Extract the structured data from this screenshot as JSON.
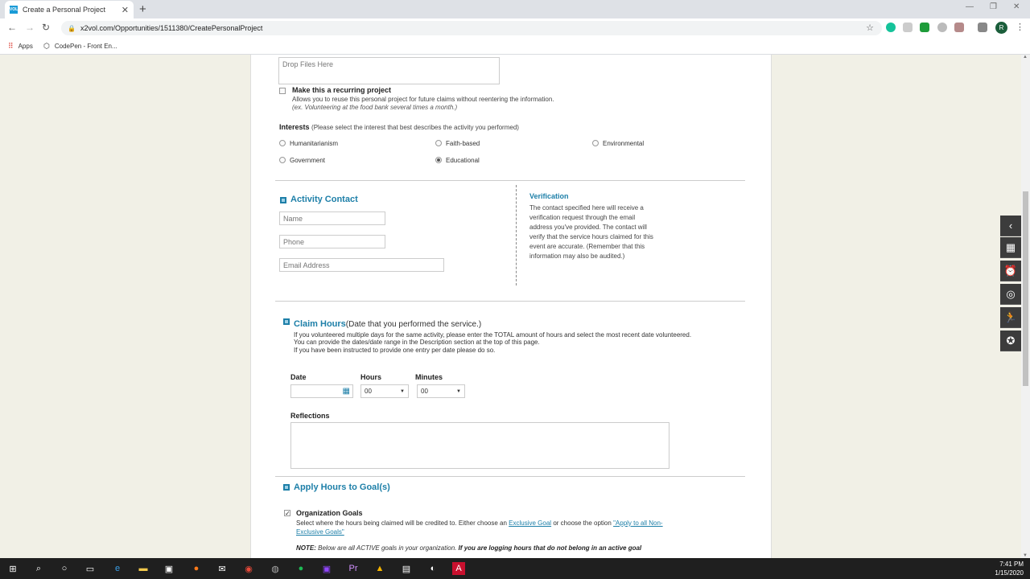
{
  "browser": {
    "tab_title": "Create a Personal Project",
    "tab_favicon": "VOL",
    "url": "x2vol.com/Opportunities/1511380/CreatePersonalProject",
    "bookmarks": [
      "Apps",
      "CodePen - Front En..."
    ],
    "avatar_letter": "R"
  },
  "page": {
    "dropzone_label": "Drop Files Here",
    "recurring": {
      "label": "Make this a recurring project",
      "desc": "Allows you to reuse this personal project for future claims without reentering the information.",
      "example": "(ex. Volunteering at the food bank several times a month.)"
    },
    "interests": {
      "title": "Interests",
      "hint": "(Please select the interest that best describes the activity you performed)",
      "options": [
        "Humanitarianism",
        "Faith-based",
        "Environmental",
        "Government",
        "Educational"
      ],
      "selected": "Educational"
    },
    "contact": {
      "title": "Activity Contact",
      "name_placeholder": "Name",
      "phone_placeholder": "Phone",
      "email_placeholder": "Email Address",
      "verification_title": "Verification",
      "verification_text": "The contact specified here will receive a verification request through the email address you've provided. The contact will verify that the service hours claimed for this event are accurate. (Remember that this information may also be audited.)"
    },
    "claim": {
      "title": "Claim Hours",
      "subtitle": "(Date that you performed the service.)",
      "line1": "If you volunteered multiple days for the same activity, please enter the TOTAL amount of hours and select the most recent date volunteered.",
      "line2": "You can provide the dates/date range in the Description section at the top of this page.",
      "line3": "If you have been instructed to provide one entry per date please do so.",
      "date_label": "Date",
      "hours_label": "Hours",
      "minutes_label": "Minutes",
      "hours_value": "00",
      "minutes_value": "00",
      "reflections_label": "Reflections"
    },
    "goals": {
      "title": "Apply Hours to Goal(s)",
      "org_label": "Organization Goals",
      "org_text_a": "Select where the hours being claimed will be credited to. Either choose an",
      "exclusive_link": "Exclusive Goal",
      "org_text_b": "or choose the option",
      "apply_link": "\"Apply to all Non-Exclusive Goals\"",
      "note_a": "NOTE:",
      "note_b": "Below are all ACTIVE goals in your organization.",
      "note_c": "If you are logging hours that do not belong in an active goal"
    }
  },
  "taskbar": {
    "time": "7:41 PM",
    "date": "1/15/2020"
  }
}
